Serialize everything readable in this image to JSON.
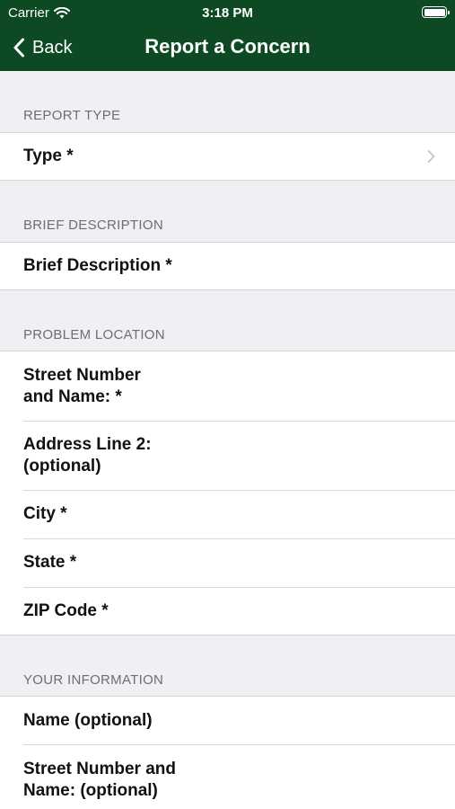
{
  "status_bar": {
    "carrier": "Carrier",
    "time": "3:18 PM",
    "battery_level": 1.0,
    "wifi_icon": "wifi-icon",
    "battery_icon": "battery-icon"
  },
  "nav": {
    "back_label": "Back",
    "title": "Report a Concern",
    "back_icon": "chevron-left-icon",
    "bar_color": "#0d4a24"
  },
  "sections": {
    "report_type": {
      "header": "REPORT TYPE",
      "rows": [
        "Type *"
      ]
    },
    "brief_description": {
      "header": "BRIEF DESCRIPTION",
      "rows": [
        "Brief Description *"
      ]
    },
    "problem_location": {
      "header": "PROBLEM LOCATION",
      "rows": [
        "Street Number and Name: *",
        "Address Line 2: (optional)",
        "City *",
        "State *",
        "ZIP Code *"
      ]
    },
    "your_information": {
      "header": "YOUR INFORMATION",
      "rows": [
        "Name (optional)",
        "Street Number and Name: (optional)"
      ]
    }
  },
  "icons": {
    "disclosure": "chevron-right-icon"
  }
}
